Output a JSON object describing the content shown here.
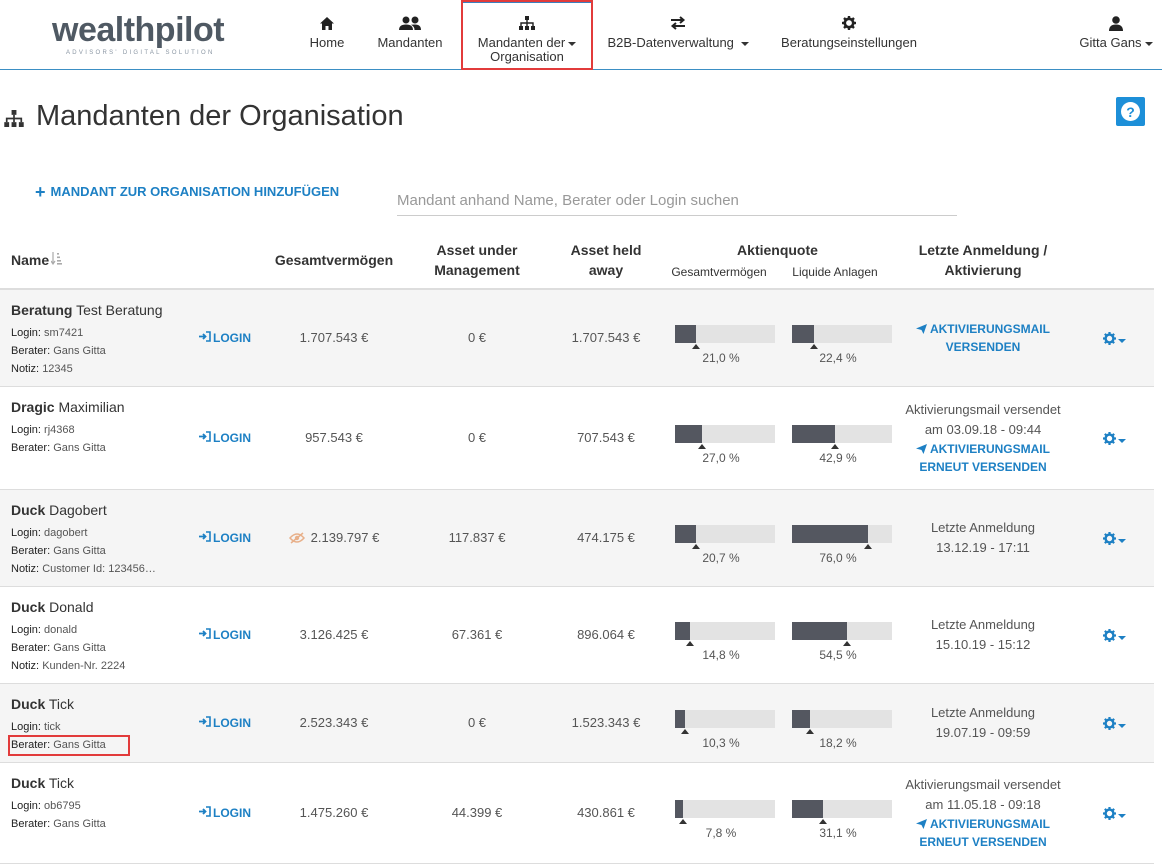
{
  "brand": {
    "name": "wealthpilot",
    "subtitle": "ADVISORS' DIGITAL SOLUTION"
  },
  "nav": {
    "home": "Home",
    "clients": "Mandanten",
    "org_clients_line1": "Mandanten der",
    "org_clients_line2": "Organisation",
    "b2b": "B2B-Datenverwaltung",
    "settings": "Beratungseinstellungen",
    "user": "Gitta Gans"
  },
  "page": {
    "title": "Mandanten der Organisation",
    "help": "?"
  },
  "toolbar": {
    "add_label": "MANDANT ZUR ORGANISATION HINZUFÜGEN",
    "search_placeholder": "Mandant anhand Name, Berater oder Login suchen"
  },
  "table": {
    "headers": {
      "name": "Name",
      "total": "Gesamtvermögen",
      "aum_1": "Asset under",
      "aum_2": "Management",
      "held_1": "Asset held",
      "held_2": "away",
      "quota": "Aktienquote",
      "quota_total": "Gesamtvermögen",
      "quota_liquid": "Liquide Anlagen",
      "last_1": "Letzte Anmeldung /",
      "last_2": "Aktivierung"
    },
    "labels": {
      "login_key": "Login:",
      "advisor_key": "Berater:",
      "note_key": "Notiz:",
      "login_button": "LOGIN"
    },
    "rows": [
      {
        "last": "Beratung",
        "first": "Test Beratung",
        "login": "sm7421",
        "advisor": "Gans Gitta",
        "note": "12345",
        "total": "1.707.543 €",
        "aum": "0 €",
        "held": "1.707.543 €",
        "quota_total": 21.0,
        "quota_total_label": "21,0 %",
        "quota_liquid": 22.4,
        "quota_liquid_label": "22,4 %",
        "status_line1": "",
        "status_line2": "",
        "action_line1": "AKTIVIERUNGSMAIL",
        "action_line2": "VERSENDEN"
      },
      {
        "last": "Dragic",
        "first": "Maximilian",
        "login": "rj4368",
        "advisor": "Gans Gitta",
        "note": "",
        "total": "957.543 €",
        "aum": "0 €",
        "held": "707.543 €",
        "quota_total": 27.0,
        "quota_total_label": "27,0 %",
        "quota_liquid": 42.9,
        "quota_liquid_label": "42,9 %",
        "status_line1": "Aktivierungsmail versendet",
        "status_line2": "am 03.09.18 - 09:44",
        "action_line1": "AKTIVIERUNGSMAIL",
        "action_line2": "ERNEUT VERSENDEN"
      },
      {
        "last": "Duck",
        "first": "Dagobert",
        "login": "dagobert",
        "advisor": "Gans Gitta",
        "note": "Customer Id: 123456…",
        "total": "2.139.797 €",
        "aum": "117.837 €",
        "held": "474.175 €",
        "quota_total": 20.7,
        "quota_total_label": "20,7 %",
        "quota_liquid": 76.0,
        "quota_liquid_label": "76,0 %",
        "status_line1": "Letzte Anmeldung",
        "status_line2": "13.12.19 - 17:11",
        "action_line1": "",
        "action_line2": ""
      },
      {
        "last": "Duck",
        "first": "Donald",
        "login": "donald",
        "advisor": "Gans Gitta",
        "note": "Kunden-Nr. 2224",
        "total": "3.126.425 €",
        "aum": "67.361 €",
        "held": "896.064 €",
        "quota_total": 14.8,
        "quota_total_label": "14,8 %",
        "quota_liquid": 54.5,
        "quota_liquid_label": "54,5 %",
        "status_line1": "Letzte Anmeldung",
        "status_line2": "15.10.19 - 15:12",
        "action_line1": "",
        "action_line2": ""
      },
      {
        "last": "Duck",
        "first": "Tick",
        "login": "tick",
        "advisor": "Gans Gitta",
        "note": "",
        "total": "2.523.343 €",
        "aum": "0 €",
        "held": "1.523.343 €",
        "quota_total": 10.3,
        "quota_total_label": "10,3 %",
        "quota_liquid": 18.2,
        "quota_liquid_label": "18,2 %",
        "status_line1": "Letzte Anmeldung",
        "status_line2": "19.07.19 - 09:59",
        "action_line1": "",
        "action_line2": ""
      },
      {
        "last": "Duck",
        "first": "Tick",
        "login": "ob6795",
        "advisor": "Gans Gitta",
        "note": "",
        "total": "1.475.260 €",
        "aum": "44.399 €",
        "held": "430.861 €",
        "quota_total": 7.8,
        "quota_total_label": "7,8 %",
        "quota_liquid": 31.1,
        "quota_liquid_label": "31,1 %",
        "status_line1": "Aktivierungsmail versendet",
        "status_line2": "am 11.05.18 - 09:18",
        "action_line1": "AKTIVIERUNGSMAIL",
        "action_line2": "ERNEUT VERSENDEN"
      }
    ]
  }
}
